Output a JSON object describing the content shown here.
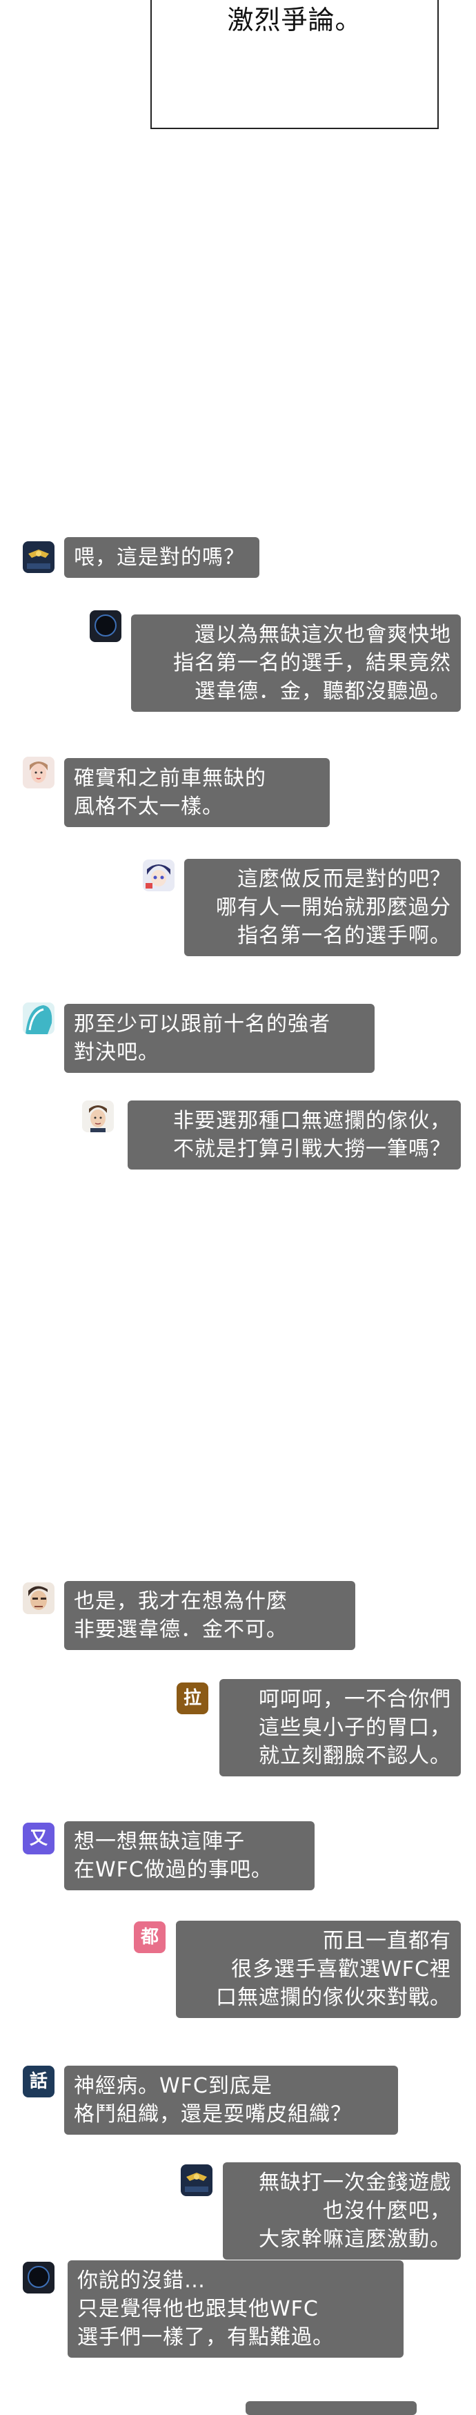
{
  "panel": {
    "text": "激烈爭論。"
  },
  "chat": {
    "messages": [
      {
        "side": "left",
        "avatar": "military-emblem-icon",
        "text": "喂，這是對的嗎？"
      },
      {
        "side": "right",
        "avatar": "dark-silhouette-icon",
        "text": "還以為無缺這次也會爽快地\n指名第一名的選手，結果竟然\n選韋德．金，聽都沒聽過。"
      },
      {
        "side": "left",
        "avatar": "woman-face-icon",
        "text": "確實和之前車無缺的\n風格不太一樣。"
      },
      {
        "side": "right",
        "avatar": "anime-character-icon",
        "text": "這麼做反而是對的吧？\n哪有人一開始就那麼過分\n指名第一名的選手啊。"
      },
      {
        "side": "left",
        "avatar": "teal-hair-icon",
        "text": "那至少可以跟前十名的強者\n對決吧。"
      },
      {
        "side": "right",
        "avatar": "man-face-icon",
        "text": "非要選那種口無遮攔的傢伙，\n不就是打算引戰大撈一筆嗎？"
      },
      {
        "side": "left",
        "avatar": "man-profile-icon",
        "text": "也是，我才在想為什麼\n非要選韋德．金不可。"
      },
      {
        "side": "right",
        "avatar": "拉",
        "text": "呵呵呵，一不合你們\n這些臭小子的胃口，\n就立刻翻臉不認人。"
      },
      {
        "side": "left",
        "avatar": "又",
        "text": "想一想無缺這陣子\n在WFC做過的事吧。"
      },
      {
        "side": "right",
        "avatar": "都",
        "text": "而且一直都有\n很多選手喜歡選WFC裡\n口無遮攔的傢伙來對戰。"
      },
      {
        "side": "left",
        "avatar": "話",
        "text": "神經病。WFC到底是\n格鬥組織，還是耍嘴皮組織？"
      },
      {
        "side": "right",
        "avatar": "military-emblem-icon",
        "text": "無缺打一次金錢遊戲\n也沒什麼吧，\n大家幹嘛這麼激動。"
      },
      {
        "side": "left",
        "avatar": "dark-silhouette-icon",
        "text": "你說的沒錯…\n只是覺得他也跟其他WFC\n選手們一樣了，有點難過。"
      }
    ]
  },
  "colors": {
    "bubble": "#6a6a6a",
    "bubble_text": "#ffffff",
    "avatar_la": "#8b5a16",
    "avatar_you": "#6a5ae0",
    "avatar_dou": "#e86f8a",
    "avatar_hua": "#1e3a5a"
  }
}
